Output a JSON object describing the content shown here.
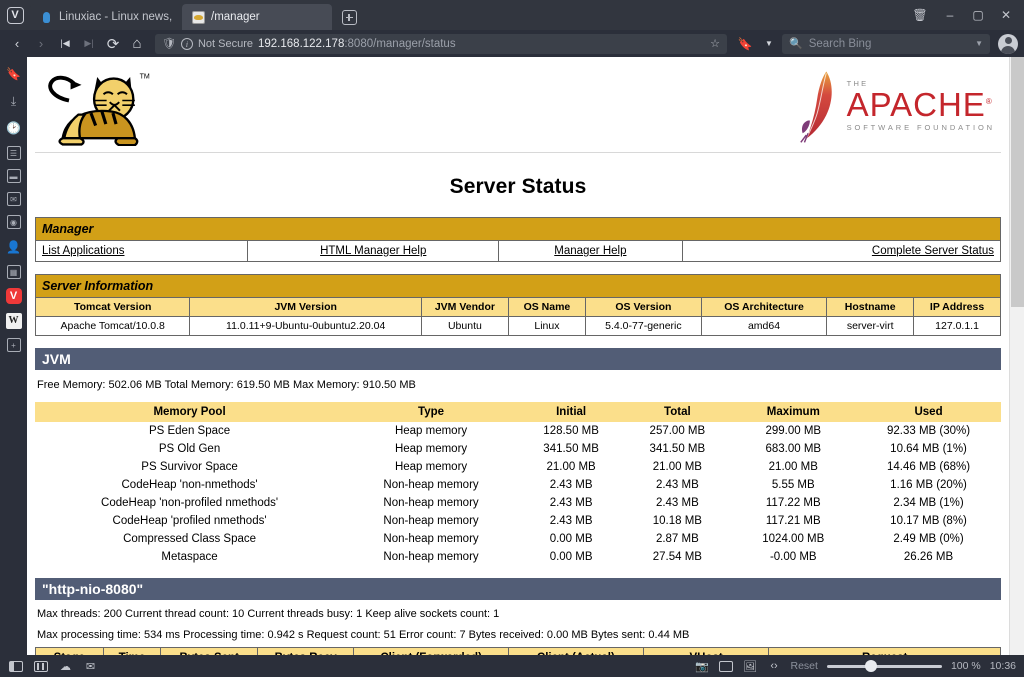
{
  "browser": {
    "app_icon": "vivaldi-logo",
    "tabs": [
      {
        "title": "Linuxiac - Linux news, tutor",
        "favicon": "linuxiac-icon",
        "active": false
      },
      {
        "title": "/manager",
        "favicon": "tomcat-icon",
        "active": true
      }
    ],
    "new_tab_label": "+",
    "window_controls": {
      "trash": "🗑",
      "minimize": "–",
      "maximize": "▢",
      "close": "✕"
    },
    "nav": {
      "back": "‹",
      "forward": "›",
      "rewind": "|◀",
      "fastforward": "▶|",
      "reload": "⟳",
      "home": "⌂"
    },
    "url": {
      "security_label": "Not Secure",
      "host": "192.168.122.178",
      "path": ":8080/manager/status",
      "bookmark_icon": "bookmark-icon",
      "dropdown_icon": "chevron-down-icon"
    },
    "search": {
      "engine_icon": "search-icon",
      "placeholder": "Search Bing",
      "dropdown_icon": "chevron-down-icon"
    },
    "profile_icon": "profile-avatar"
  },
  "sidebar": {
    "items": [
      {
        "name": "bookmarks",
        "glyph": "☐"
      },
      {
        "name": "downloads",
        "glyph": "⤓"
      },
      {
        "name": "history",
        "glyph": "◴"
      },
      {
        "name": "notes",
        "glyph": "☰"
      },
      {
        "name": "window-panel",
        "glyph": "▤"
      },
      {
        "name": "mail",
        "glyph": "✉"
      },
      {
        "name": "feeds",
        "glyph": "◔"
      },
      {
        "name": "contacts",
        "glyph": "♟"
      },
      {
        "name": "calendar",
        "glyph": "▦"
      },
      {
        "name": "vivaldi-panel",
        "glyph": "V"
      },
      {
        "name": "wikipedia-panel",
        "glyph": "W"
      },
      {
        "name": "add-panel",
        "glyph": "+"
      }
    ]
  },
  "page": {
    "title": "Server Status",
    "tomcat_logo_alt": "Apache Tomcat logo",
    "apache_logo": {
      "the": "THE",
      "name": "APACHE",
      "sub": "SOFTWARE FOUNDATION",
      "trademark": "®"
    },
    "manager": {
      "header": "Manager",
      "links": [
        "List Applications",
        "HTML Manager Help",
        "Manager Help",
        "Complete Server Status"
      ]
    },
    "server_information": {
      "header": "Server Information",
      "columns": [
        "Tomcat Version",
        "JVM Version",
        "JVM Vendor",
        "OS Name",
        "OS Version",
        "OS Architecture",
        "Hostname",
        "IP Address"
      ],
      "values": [
        "Apache Tomcat/10.0.8",
        "11.0.11+9-Ubuntu-0ubuntu2.20.04",
        "Ubuntu",
        "Linux",
        "5.4.0-77-generic",
        "amd64",
        "server-virt",
        "127.0.1.1"
      ]
    },
    "jvm": {
      "header": "JVM",
      "summary": "Free Memory: 502.06 MB Total Memory: 619.50 MB Max Memory: 910.50 MB",
      "columns": [
        "Memory Pool",
        "Type",
        "Initial",
        "Total",
        "Maximum",
        "Used"
      ],
      "rows": [
        [
          "PS Eden Space",
          "Heap memory",
          "128.50 MB",
          "257.00 MB",
          "299.00 MB",
          "92.33 MB (30%)"
        ],
        [
          "PS Old Gen",
          "Heap memory",
          "341.50 MB",
          "341.50 MB",
          "683.00 MB",
          "10.64 MB (1%)"
        ],
        [
          "PS Survivor Space",
          "Heap memory",
          "21.00 MB",
          "21.00 MB",
          "21.00 MB",
          "14.46 MB (68%)"
        ],
        [
          "CodeHeap 'non-nmethods'",
          "Non-heap memory",
          "2.43 MB",
          "2.43 MB",
          "5.55 MB",
          "1.16 MB (20%)"
        ],
        [
          "CodeHeap 'non-profiled nmethods'",
          "Non-heap memory",
          "2.43 MB",
          "2.43 MB",
          "117.22 MB",
          "2.34 MB (1%)"
        ],
        [
          "CodeHeap 'profiled nmethods'",
          "Non-heap memory",
          "2.43 MB",
          "10.18 MB",
          "117.21 MB",
          "10.17 MB (8%)"
        ],
        [
          "Compressed Class Space",
          "Non-heap memory",
          "0.00 MB",
          "2.87 MB",
          "1024.00 MB",
          "2.49 MB (0%)"
        ],
        [
          "Metaspace",
          "Non-heap memory",
          "0.00 MB",
          "27.54 MB",
          "-0.00 MB",
          "26.26 MB"
        ]
      ]
    },
    "connector": {
      "header": "\"http-nio-8080\"",
      "line1": "Max threads: 200 Current thread count: 10 Current threads busy: 1 Keep alive sockets count: 1",
      "line2": "Max processing time: 534 ms Processing time: 0.942 s Request count: 51 Error count: 7 Bytes received: 0.00 MB Bytes sent: 0.44 MB",
      "request_columns": [
        "Stage",
        "Time",
        "Bytes Sent",
        "Bytes Recv",
        "Client (Forwarded)",
        "Client (Actual)",
        "VHost",
        "Request"
      ]
    }
  },
  "statusbar": {
    "left_icons": [
      "panel-toggle-icon",
      "tiling-icon",
      "weather-icon",
      "mail-icon"
    ],
    "right_icons": [
      "capture-icon",
      "tile-icon",
      "image-icon",
      "code-icon"
    ],
    "reset_label": "Reset",
    "zoom_level": "100 %",
    "clock": "10:36"
  },
  "colors": {
    "gold_header": "#d2a017",
    "gold_light": "#fbdf8b",
    "slate_header": "#525d76",
    "chrome_dark": "#2b2f3a",
    "apache_red": "#c4262c"
  }
}
